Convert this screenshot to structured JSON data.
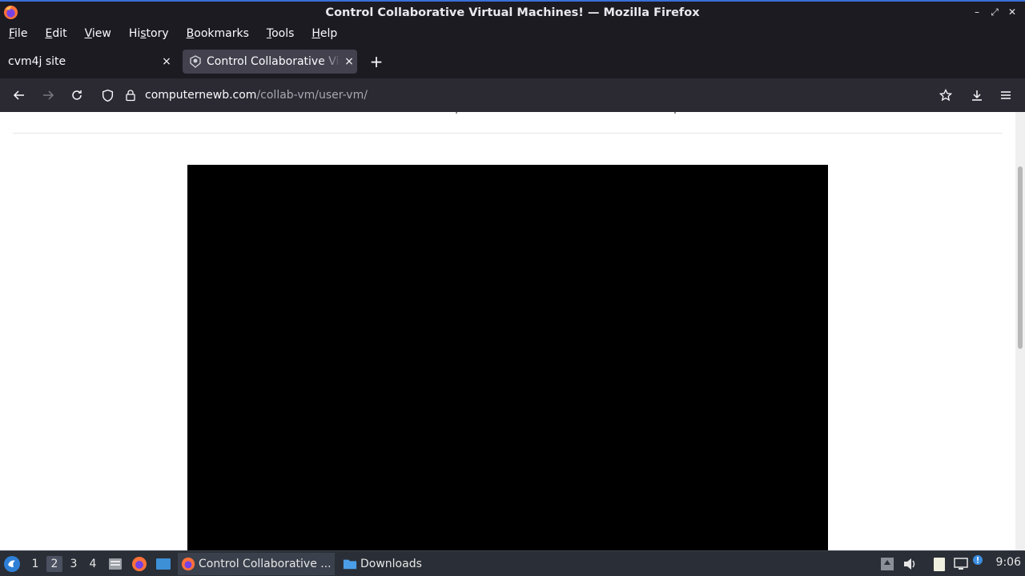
{
  "window": {
    "title": "Control Collaborative Virtual Machines! — Mozilla Firefox",
    "minimize_glyph": "–",
    "maximize_glyph": "⤢",
    "close_glyph": "✕"
  },
  "menubar": {
    "items": [
      {
        "label": "File",
        "accel": "F",
        "rest": "ile"
      },
      {
        "label": "Edit",
        "accel": "E",
        "rest": "dit"
      },
      {
        "label": "View",
        "accel": "V",
        "rest": "iew"
      },
      {
        "label": "History",
        "pre": "Hi",
        "accel": "s",
        "rest": "tory"
      },
      {
        "label": "Bookmarks",
        "accel": "B",
        "rest": "ookmarks"
      },
      {
        "label": "Tools",
        "accel": "T",
        "rest": "ools"
      },
      {
        "label": "Help",
        "accel": "H",
        "rest": "elp"
      }
    ]
  },
  "tabs": [
    {
      "label": "cvm4j site",
      "active": false
    },
    {
      "label": "Control Collaborative Virtual Machines!",
      "active": true
    }
  ],
  "newtab_glyph": "+",
  "tab_close_glyph": "×",
  "navbar": {
    "url_host": "computernewb.com",
    "url_path": "/collab-vm/user-vm/"
  },
  "taskbar": {
    "workspaces": [
      "1",
      "2",
      "3",
      "4"
    ],
    "active_workspace": "2",
    "tasks": [
      {
        "label": "Control Collaborative ...",
        "icon": "firefox-icon"
      },
      {
        "label": "Downloads",
        "icon": "folder-icon"
      }
    ],
    "clock": "9:06"
  },
  "colors": {
    "chrome_bg": "#1c1b22",
    "toolbar_bg": "#2b2a33",
    "active_tab_bg": "#42414d",
    "accent": "#3b6fd8",
    "vm_screen": "#000000"
  }
}
